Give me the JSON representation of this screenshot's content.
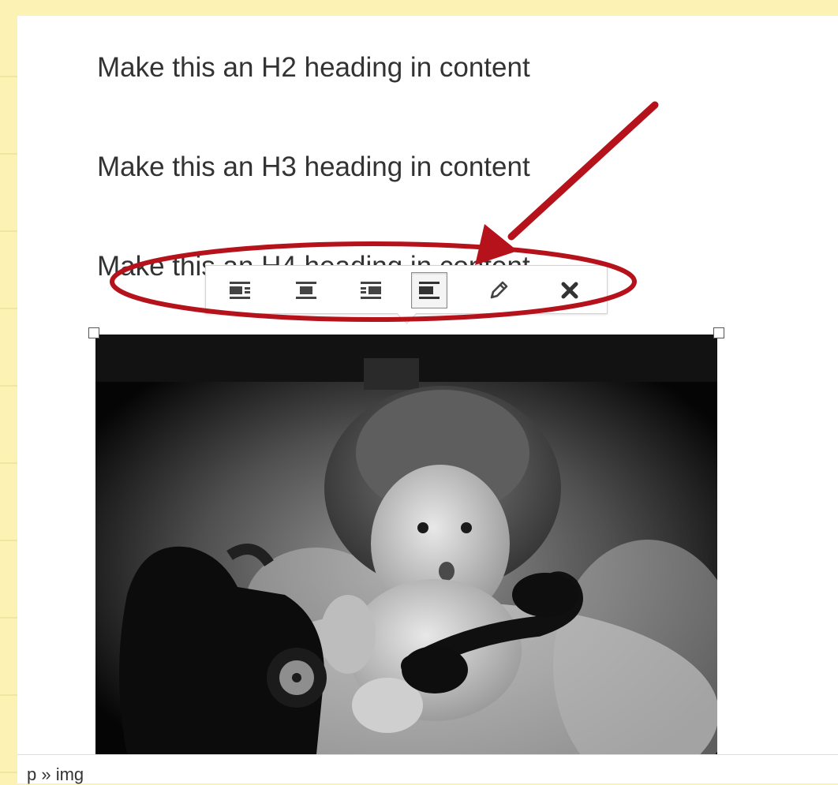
{
  "content": {
    "paragraphs": [
      "Make this an H2 heading in content",
      "Make this an H3 heading in content",
      "Make this an H4 heading in content"
    ]
  },
  "image_toolbar": {
    "buttons": [
      {
        "name": "align-left",
        "icon": "align-left-icon",
        "active": false
      },
      {
        "name": "align-center",
        "icon": "align-center-icon",
        "active": false
      },
      {
        "name": "align-right",
        "icon": "align-right-icon",
        "active": false
      },
      {
        "name": "no-alignment",
        "icon": "align-none-icon",
        "active": true
      },
      {
        "name": "edit",
        "icon": "pencil-icon",
        "active": false
      },
      {
        "name": "remove",
        "icon": "close-icon",
        "active": false
      }
    ]
  },
  "status": {
    "element_path": "p » img"
  },
  "colors": {
    "page_background": "#fbf2b4",
    "annotation": "#b5121b",
    "text": "#333333"
  }
}
